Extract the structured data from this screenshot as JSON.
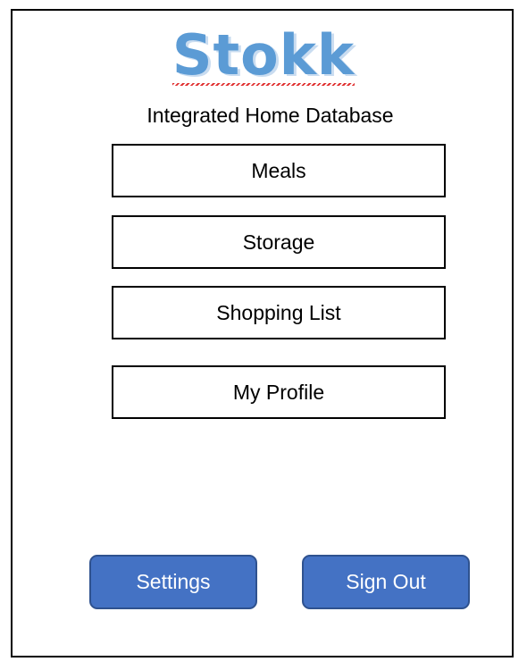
{
  "app": {
    "logo_text": "Stokk",
    "subtitle": "Integrated Home Database"
  },
  "menu": {
    "items": [
      {
        "label": "Meals"
      },
      {
        "label": "Storage"
      },
      {
        "label": "Shopping List"
      },
      {
        "label": "My Profile"
      }
    ]
  },
  "actions": {
    "settings_label": "Settings",
    "signout_label": "Sign Out"
  },
  "colors": {
    "logo": "#5b9bd5",
    "logo_shadow": "#c9dcf0",
    "action_button_fill": "#4472c4",
    "action_button_border": "#2f528f",
    "spellcheck_underline": "#e03030"
  }
}
